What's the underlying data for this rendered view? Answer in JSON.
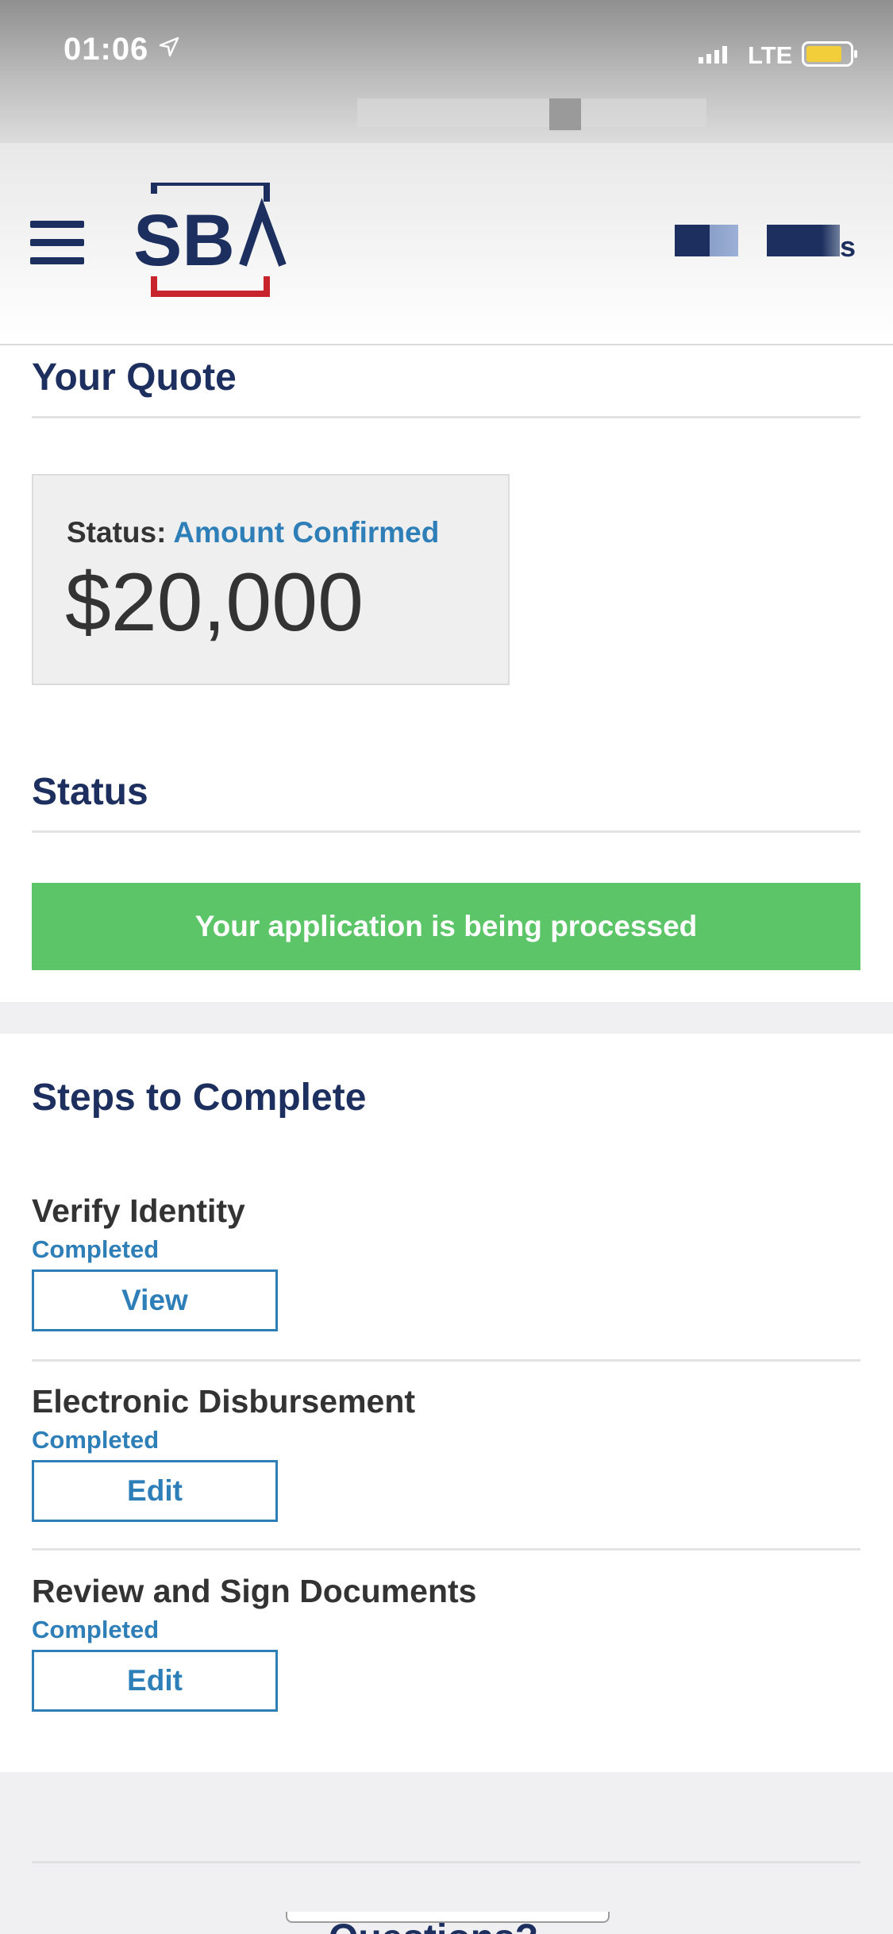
{
  "status_bar": {
    "time": "01:06",
    "network": "LTE"
  },
  "header": {
    "logo_text": "SBA",
    "user_initial": "s",
    "menu_icon": "hamburger-menu-icon"
  },
  "quote": {
    "heading": "Your Quote",
    "status_label": "Status:",
    "status_value": "Amount Confirmed",
    "amount": "$20,000"
  },
  "status": {
    "heading": "Status",
    "banner": "Your application is being processed"
  },
  "steps": {
    "heading": "Steps to Complete",
    "items": [
      {
        "title": "Verify Identity",
        "status": "Completed",
        "button": "View"
      },
      {
        "title": "Electronic Disbursement",
        "status": "Completed",
        "button": "Edit"
      },
      {
        "title": "Review and Sign Documents",
        "status": "Completed",
        "button": "Edit"
      }
    ]
  },
  "footer": {
    "heading": "Questions?"
  },
  "colors": {
    "navy": "#1c2f5e",
    "link_blue": "#2e7fb8",
    "success_green": "#5cc568",
    "logo_red": "#c8242b"
  }
}
